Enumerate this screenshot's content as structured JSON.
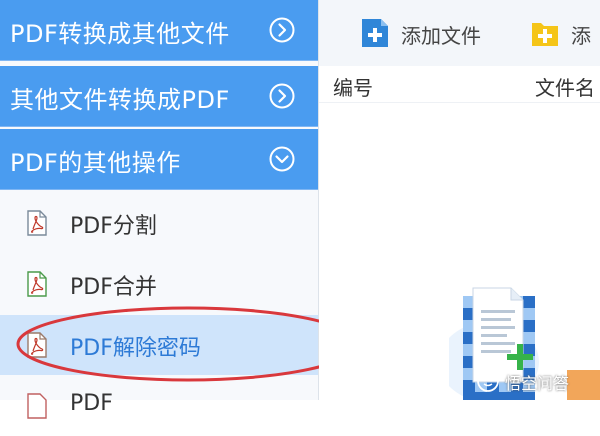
{
  "sidebar": {
    "categories": [
      {
        "label": "PDF转换成其他文件",
        "state": "collapsed"
      },
      {
        "label": "其他文件转换成PDF",
        "state": "collapsed"
      },
      {
        "label": "PDF的其他操作",
        "state": "expanded"
      }
    ],
    "items": [
      {
        "label": "PDF分割"
      },
      {
        "label": "PDF合并"
      },
      {
        "label": "PDF解除密码",
        "selected": true
      },
      {
        "label": "PDF"
      }
    ]
  },
  "toolbar": {
    "add_file_label": "添加文件",
    "add_folder_label": "添"
  },
  "table": {
    "columns": [
      "编号",
      "文件名"
    ]
  },
  "watermark": {
    "text": "悟空问答"
  },
  "colors": {
    "category_bg": "#4a9cf0",
    "selected_bg": "#cfe4fb",
    "annotation": "#d9383c",
    "accent_blue": "#2f86d8",
    "folder_yellow": "#f5c518"
  },
  "icons": {
    "category_collapsed": "chevron-right-circle-icon",
    "category_expanded": "chevron-down-circle-icon",
    "item": "pdf-file-icon",
    "add_file": "add-file-icon",
    "add_folder": "add-folder-icon"
  }
}
